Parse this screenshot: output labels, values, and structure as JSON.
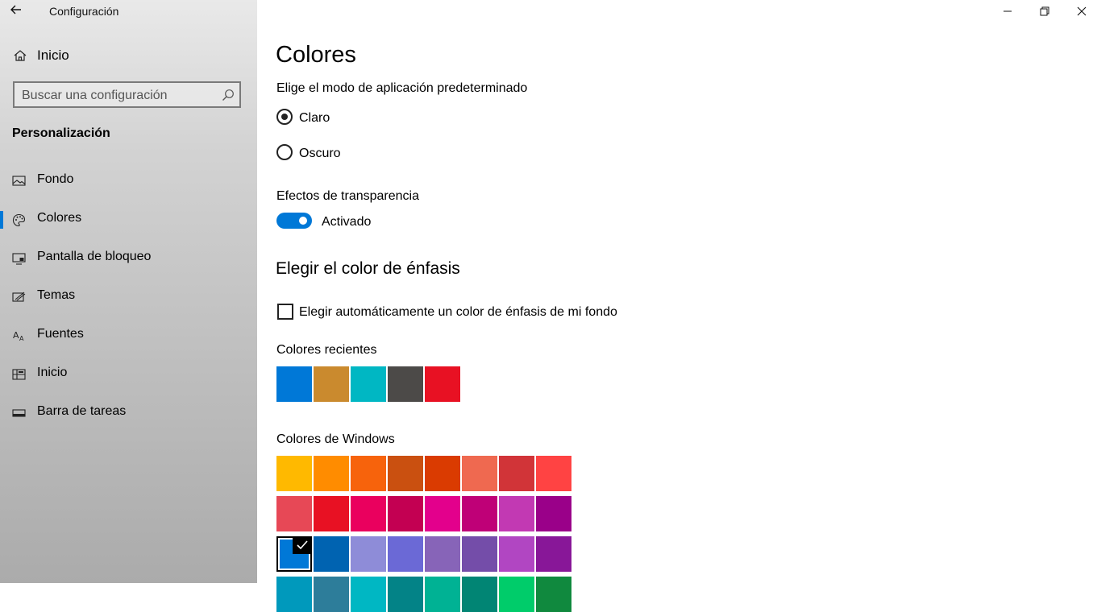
{
  "window": {
    "title": "Configuración",
    "controls": [
      "minimize-icon",
      "restore-icon",
      "close-icon"
    ]
  },
  "sidebar": {
    "home_label": "Inicio",
    "search_placeholder": "Buscar una configuración",
    "section_title": "Personalización",
    "items": [
      {
        "label": "Fondo",
        "icon": "picture-icon"
      },
      {
        "label": "Colores",
        "icon": "palette-icon",
        "active": true
      },
      {
        "label": "Pantalla de bloqueo",
        "icon": "lock-screen-icon"
      },
      {
        "label": "Temas",
        "icon": "themes-icon"
      },
      {
        "label": "Fuentes",
        "icon": "fonts-icon"
      },
      {
        "label": "Inicio",
        "icon": "start-icon"
      },
      {
        "label": "Barra de tareas",
        "icon": "taskbar-icon"
      }
    ],
    "accent_color": "#0078d7"
  },
  "main": {
    "title": "Colores",
    "app_mode": {
      "label": "Elige el modo de aplicación predeterminado",
      "options": [
        "Claro",
        "Oscuro"
      ],
      "selected": "Claro"
    },
    "transparency": {
      "label": "Efectos de transparencia",
      "state_label": "Activado",
      "on": true
    },
    "accent_heading": "Elegir el color de énfasis",
    "auto_accent_label": "Elegir automáticamente un color de énfasis de mi fondo",
    "auto_accent_checked": false,
    "recent_label": "Colores recientes",
    "recent_colors": [
      "#0078d7",
      "#ca8a2e",
      "#00b7c3",
      "#4c4a48",
      "#e81123"
    ],
    "windows_label": "Colores de Windows",
    "windows_colors": [
      [
        "#ffb900",
        "#ff8c00",
        "#f7630c",
        "#ca5010",
        "#da3b01",
        "#ef6950",
        "#d13438",
        "#ff4343"
      ],
      [
        "#e74856",
        "#e81123",
        "#ea005e",
        "#c30052",
        "#e3008c",
        "#bf0077",
        "#c239b3",
        "#9a0089"
      ],
      [
        "#0078d7",
        "#0063b1",
        "#8e8cd8",
        "#6b69d6",
        "#8764b8",
        "#744da9",
        "#b146c2",
        "#881798"
      ],
      [
        "#0099bc",
        "#2d7d9a",
        "#00b7c3",
        "#038387",
        "#00b294",
        "#018574",
        "#00cc6a",
        "#10893e"
      ]
    ],
    "selected_color": "#0078d7"
  }
}
